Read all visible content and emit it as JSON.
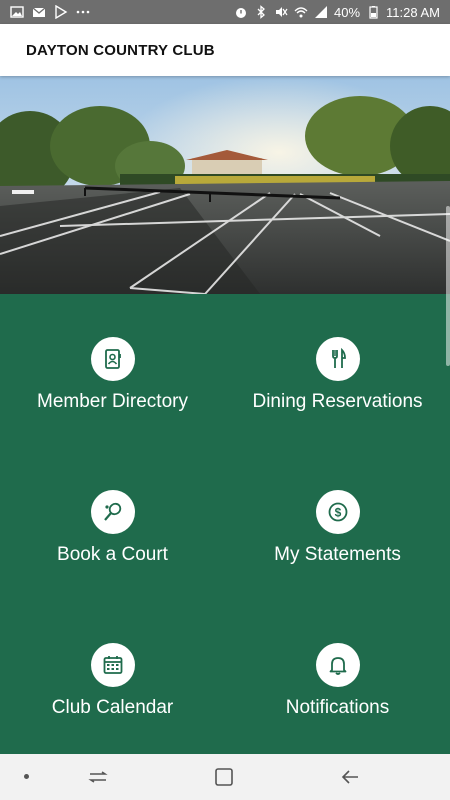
{
  "status_bar": {
    "battery": "40%",
    "time": "11:28 AM",
    "icons_left": [
      "image-icon",
      "mail-icon",
      "play-store-icon",
      "more-dots-icon"
    ],
    "icons_right": [
      "alarm-icon",
      "bluetooth-icon",
      "mute-icon",
      "wifi-icon",
      "signal-icon",
      "battery-icon"
    ]
  },
  "app_bar": {
    "title": "DAYTON COUNTRY CLUB"
  },
  "hero": {
    "alt": "tennis courts"
  },
  "tiles": [
    {
      "label": "Member Directory",
      "icon": "contacts-book-icon"
    },
    {
      "label": "Dining Reservations",
      "icon": "fork-knife-icon"
    },
    {
      "label": "Book a Court",
      "icon": "tennis-racket-icon"
    },
    {
      "label": "My Statements",
      "icon": "dollar-icon"
    },
    {
      "label": "Club Calendar",
      "icon": "calendar-icon"
    },
    {
      "label": "Notifications",
      "icon": "bell-icon"
    }
  ],
  "colors": {
    "primary": "#1f6b4c",
    "app_bar": "#ffffff",
    "status_bar": "#6e6e6e"
  },
  "nav_bar": {
    "buttons": [
      "recents-button",
      "home-button",
      "back-button"
    ]
  }
}
